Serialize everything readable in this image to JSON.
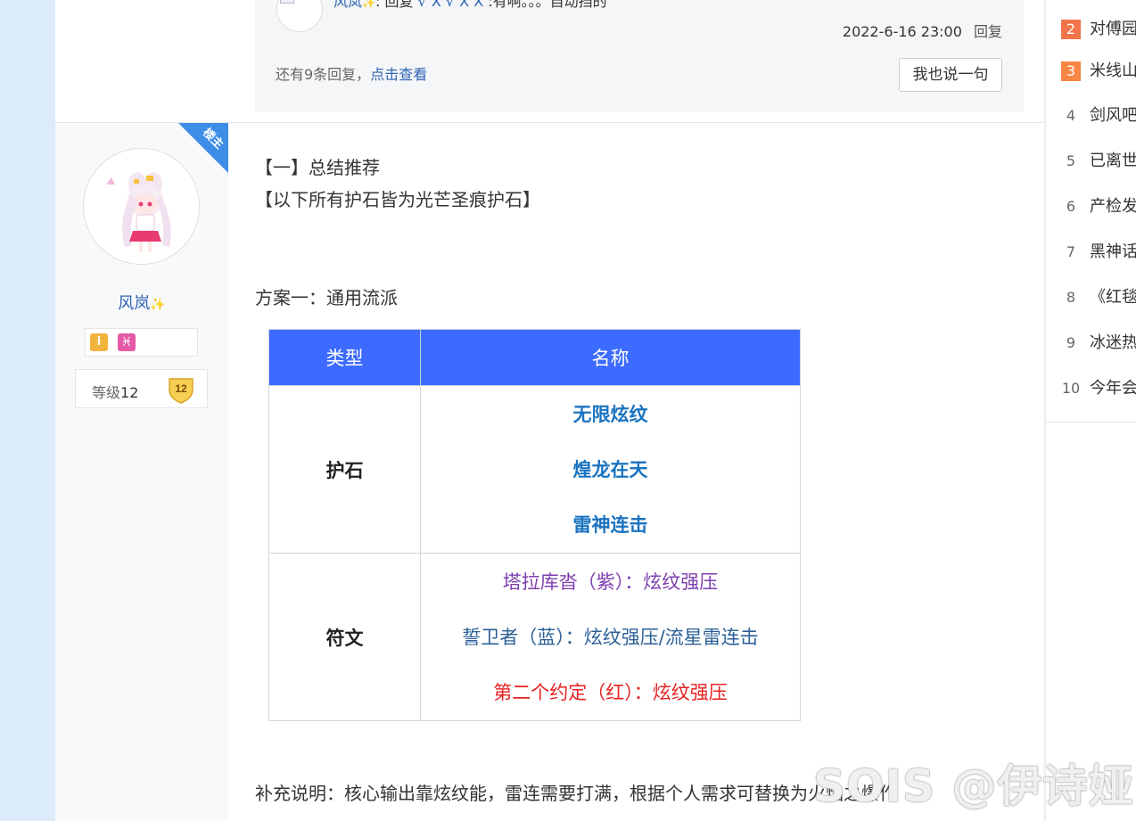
{
  "reply": {
    "author": "风岚",
    "reply_prefix": ": 回复",
    "reply_target": "√ X √ X X",
    "reply_text": ":有啊。。。自动挡的",
    "timestamp": "2022-6-16 23:00",
    "reply_label": "回复",
    "more_prefix": "还有9条回复，",
    "more_link": "点击查看",
    "say_button": "我也说一句"
  },
  "author": {
    "badge": "楼主",
    "name": "风岚",
    "sparkle": "✨",
    "vip_icon": "vip-icon",
    "zodiac_icon": "pisces-icon",
    "level_label": "等级",
    "level_num": "12",
    "shield_num": "12"
  },
  "post": {
    "line1": "【一】总结推荐",
    "line2": "【以下所有护石皆为光芒圣痕护石】",
    "line3": "方案一：通用流派",
    "line4": "补充说明：核心输出靠炫纹能，雷连需要打满，根据个人需求可替换为火焰之爆作"
  },
  "table": {
    "headers": [
      "类型",
      "名称"
    ],
    "row1_type": "护石",
    "stones": [
      "无限炫纹",
      "煌龙在天",
      "雷神连击"
    ],
    "row2_type": "符文",
    "runes": [
      "塔拉库沓（紫）：炫纹强压",
      "誓卫者（蓝）：炫纹强压/流星雷连击",
      "第二个约定（红）：炫纹强压"
    ],
    "colors": {
      "header_bg": "#3d6bff",
      "stone": "#1a73c0",
      "purple": "#7d3eae",
      "blue": "#2b5f97",
      "red": "#e62222"
    }
  },
  "sidebar": {
    "ranks": [
      {
        "num": "2",
        "title": "对傅园"
      },
      {
        "num": "3",
        "title": "米线山"
      },
      {
        "num": "4",
        "title": "剑风吧"
      },
      {
        "num": "5",
        "title": "已离世"
      },
      {
        "num": "6",
        "title": "产检发"
      },
      {
        "num": "7",
        "title": "黑神话"
      },
      {
        "num": "8",
        "title": "《红毯"
      },
      {
        "num": "9",
        "title": "冰迷热"
      },
      {
        "num": "10",
        "title": "今年会"
      }
    ]
  },
  "watermark": "SOIS @伊诗娅"
}
